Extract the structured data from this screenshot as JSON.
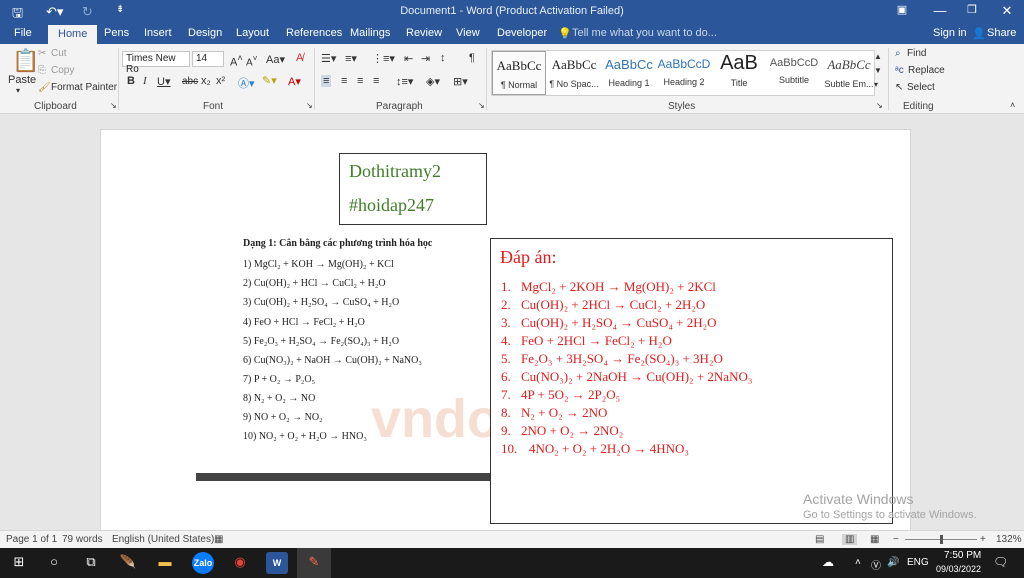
{
  "window": {
    "title": "Document1 - Word (Product Activation Failed)"
  },
  "ribbon_tabs": [
    "File",
    "Home",
    "Pens",
    "Insert",
    "Design",
    "Layout",
    "References",
    "Mailings",
    "Review",
    "View",
    "Developer"
  ],
  "tell_me": "Tell me what you want to do...",
  "account": {
    "sign_in": "Sign in",
    "share": "Share"
  },
  "clipboard": {
    "paste": "Paste",
    "cut": "Cut",
    "copy": "Copy",
    "format_painter": "Format Painter",
    "label": "Clipboard"
  },
  "font": {
    "name": "Times New Ro",
    "size": "14",
    "label": "Font"
  },
  "paragraph": {
    "label": "Paragraph"
  },
  "styles": {
    "label": "Styles",
    "items": [
      {
        "sample": "AaBbCc",
        "name": "¶ Normal"
      },
      {
        "sample": "AaBbCc",
        "name": "¶ No Spac..."
      },
      {
        "sample": "AaBbCc",
        "name": "Heading 1"
      },
      {
        "sample": "AaBbCcD",
        "name": "Heading 2"
      },
      {
        "sample": "AaB",
        "name": "Title"
      },
      {
        "sample": "AaBbCcD",
        "name": "Subtitle"
      },
      {
        "sample": "AaBbCc",
        "name": "Subtle Em..."
      }
    ]
  },
  "editing": {
    "find": "Find",
    "replace": "Replace",
    "select": "Select",
    "label": "Editing"
  },
  "document": {
    "name_box": {
      "line1": "Dothitramy2",
      "line2": "#hoidap247"
    },
    "worksheet": {
      "title": "Dạng 1: Cân bằng các phương trình hóa học",
      "lines": [
        "1) MgCl₂ + KOH → Mg(OH)₂ + KCl",
        "2) Cu(OH)₂ + HCl → CuCl₂ + H₂O",
        "3) Cu(OH)₂ + H₂SO₄ → CuSO₄ + H₂O",
        "4) FeO + HCl → FeCl₂ + H₂O",
        "5) Fe₂O₃ + H₂SO₄ → Fe₂(SO₄)₃ + H₂O",
        "6) Cu(NO₃)₂ + NaOH → Cu(OH)₂ + NaNO₃",
        "7) P + O₂ → P₂O₅",
        "8) N₂ + O₂ → NO",
        "9) NO + O₂ → NO₂",
        "10) NO₂ + O₂ + H₂O → HNO₃"
      ],
      "watermark": "vndoc"
    },
    "answer": {
      "title": "Đáp án:",
      "lines": [
        {
          "num": "1.",
          "text": "MgCl₂  +  2KOH  →  Mg(OH)₂  +  2KCl"
        },
        {
          "num": "2.",
          "text": "Cu(OH)₂  +  2HCl  → CuCl₂  +  2H₂O"
        },
        {
          "num": "3.",
          "text": "Cu(OH)₂  +  H₂SO₄  → CuSO₄  +  2H₂O"
        },
        {
          "num": "4.",
          "text": "FeO  +  2HCl  → FeCl₂  +  H₂O"
        },
        {
          "num": "5.",
          "text": "Fe₂O₃  +  3H₂SO₄  →  Fe₂(SO₄)₃  +  3H₂O"
        },
        {
          "num": "6.",
          "text": "Cu(NO₃)₂  + 2NaOH  →  Cu(OH)₂  +  2NaNO₃"
        },
        {
          "num": "7.",
          "text": "4P  +  5O₂  →  2P₂O₅"
        },
        {
          "num": "8.",
          "text": "N₂  +  O₂  → 2NO"
        },
        {
          "num": "9.",
          "text": "2NO  +  O₂  →  2NO₂"
        },
        {
          "num": "10.",
          "text": "4NO₂  +  O₂  +  2H₂O  → 4HNO₃"
        }
      ]
    }
  },
  "activation": {
    "line1": "Activate Windows",
    "line2": "Go to Settings to activate Windows."
  },
  "status": {
    "page": "Page 1 of 1",
    "words": "79 words",
    "language": "English (United States)",
    "zoom": "132%"
  },
  "taskbar": {
    "time": "7:50 PM",
    "date": "09/03/2022",
    "lang": "ENG",
    "zalo": "Zalo",
    "word": "W"
  }
}
